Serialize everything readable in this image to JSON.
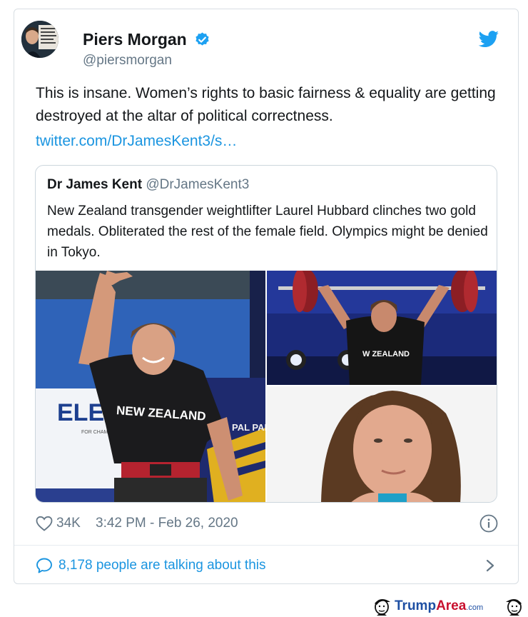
{
  "tweet": {
    "author_name": "Piers Morgan",
    "handle": "@piersmorgan",
    "text": "This is insane. Women’s rights to basic fairness & equality are getting destroyed at the altar of political correctness.",
    "link": "twitter.com/DrJamesKent3/s…",
    "likes": "34K",
    "timestamp": "3:42 PM - Feb 26, 2020",
    "talking": "8,178 people are talking about this"
  },
  "quoted": {
    "author_name": "Dr James Kent",
    "handle": "@DrJamesKent3",
    "text": "New Zealand transgender weightlifter Laurel Hubbard clinches two gold medals. Obliterated the rest of the female field. Olympics might be denied in Tokyo.",
    "photo_labels": {
      "shirt_left": "NEW ZEALAND",
      "banner": "ELE",
      "banner_small": "FOR CHAMPIONS",
      "banner_right": "PAL PAR",
      "shirt_right": "W ZEALAND"
    }
  },
  "watermark": {
    "part1": "Trump",
    "part2": "Area",
    "part3": ".com"
  },
  "icons": {
    "verified": "verified-badge-icon",
    "bird": "twitter-bird-icon",
    "heart": "heart-icon",
    "info": "info-icon",
    "reply": "speech-bubble-icon",
    "chevron": "chevron-right-icon"
  },
  "colors": {
    "twitter_blue": "#1da1f2",
    "link_blue": "#1b95e0",
    "text": "#14171a",
    "muted": "#657786",
    "border": "#ccd6dd"
  }
}
